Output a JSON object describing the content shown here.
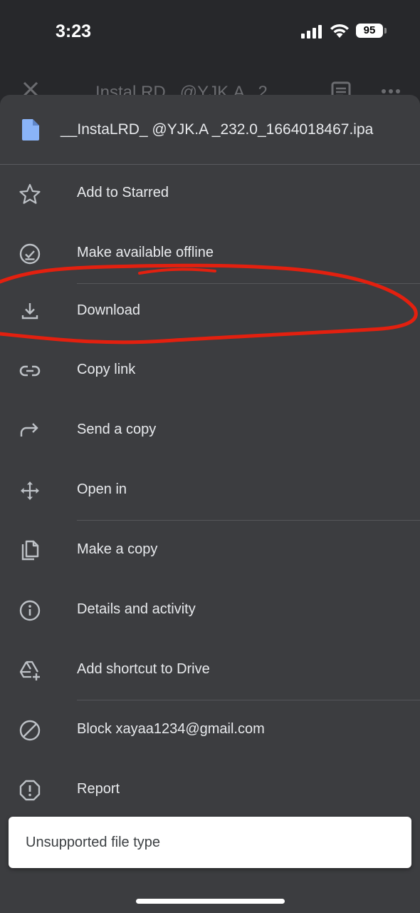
{
  "status_bar": {
    "time": "3:23",
    "battery": "95"
  },
  "background_header": {
    "title": "Instal.RD_ @YJK.A _2"
  },
  "sheet": {
    "file_name": "__InstaLRD_ @YJK.A _232.0_1664018467.ipa",
    "items": [
      {
        "label": "Add to Starred",
        "icon": "star-outline-icon"
      },
      {
        "label": "Make available offline",
        "icon": "offline-check-icon"
      },
      {
        "label": "Download",
        "icon": "download-icon"
      },
      {
        "label": "Copy link",
        "icon": "link-icon"
      },
      {
        "label": "Send a copy",
        "icon": "share-arrow-icon"
      },
      {
        "label": "Open in",
        "icon": "open-in-icon"
      },
      {
        "label": "Make a copy",
        "icon": "copy-icon"
      },
      {
        "label": "Details and activity",
        "icon": "info-icon"
      },
      {
        "label": "Add shortcut to Drive",
        "icon": "drive-shortcut-icon"
      },
      {
        "label": "Block xayaa1234@gmail.com",
        "icon": "block-icon"
      },
      {
        "label": "Report",
        "icon": "report-icon"
      }
    ]
  },
  "snackbar": {
    "message": "Unsupported file type"
  },
  "colors": {
    "sheet_bg": "#3c3d40",
    "file_icon": "#8ab4f8",
    "annotation": "#e3200f"
  }
}
